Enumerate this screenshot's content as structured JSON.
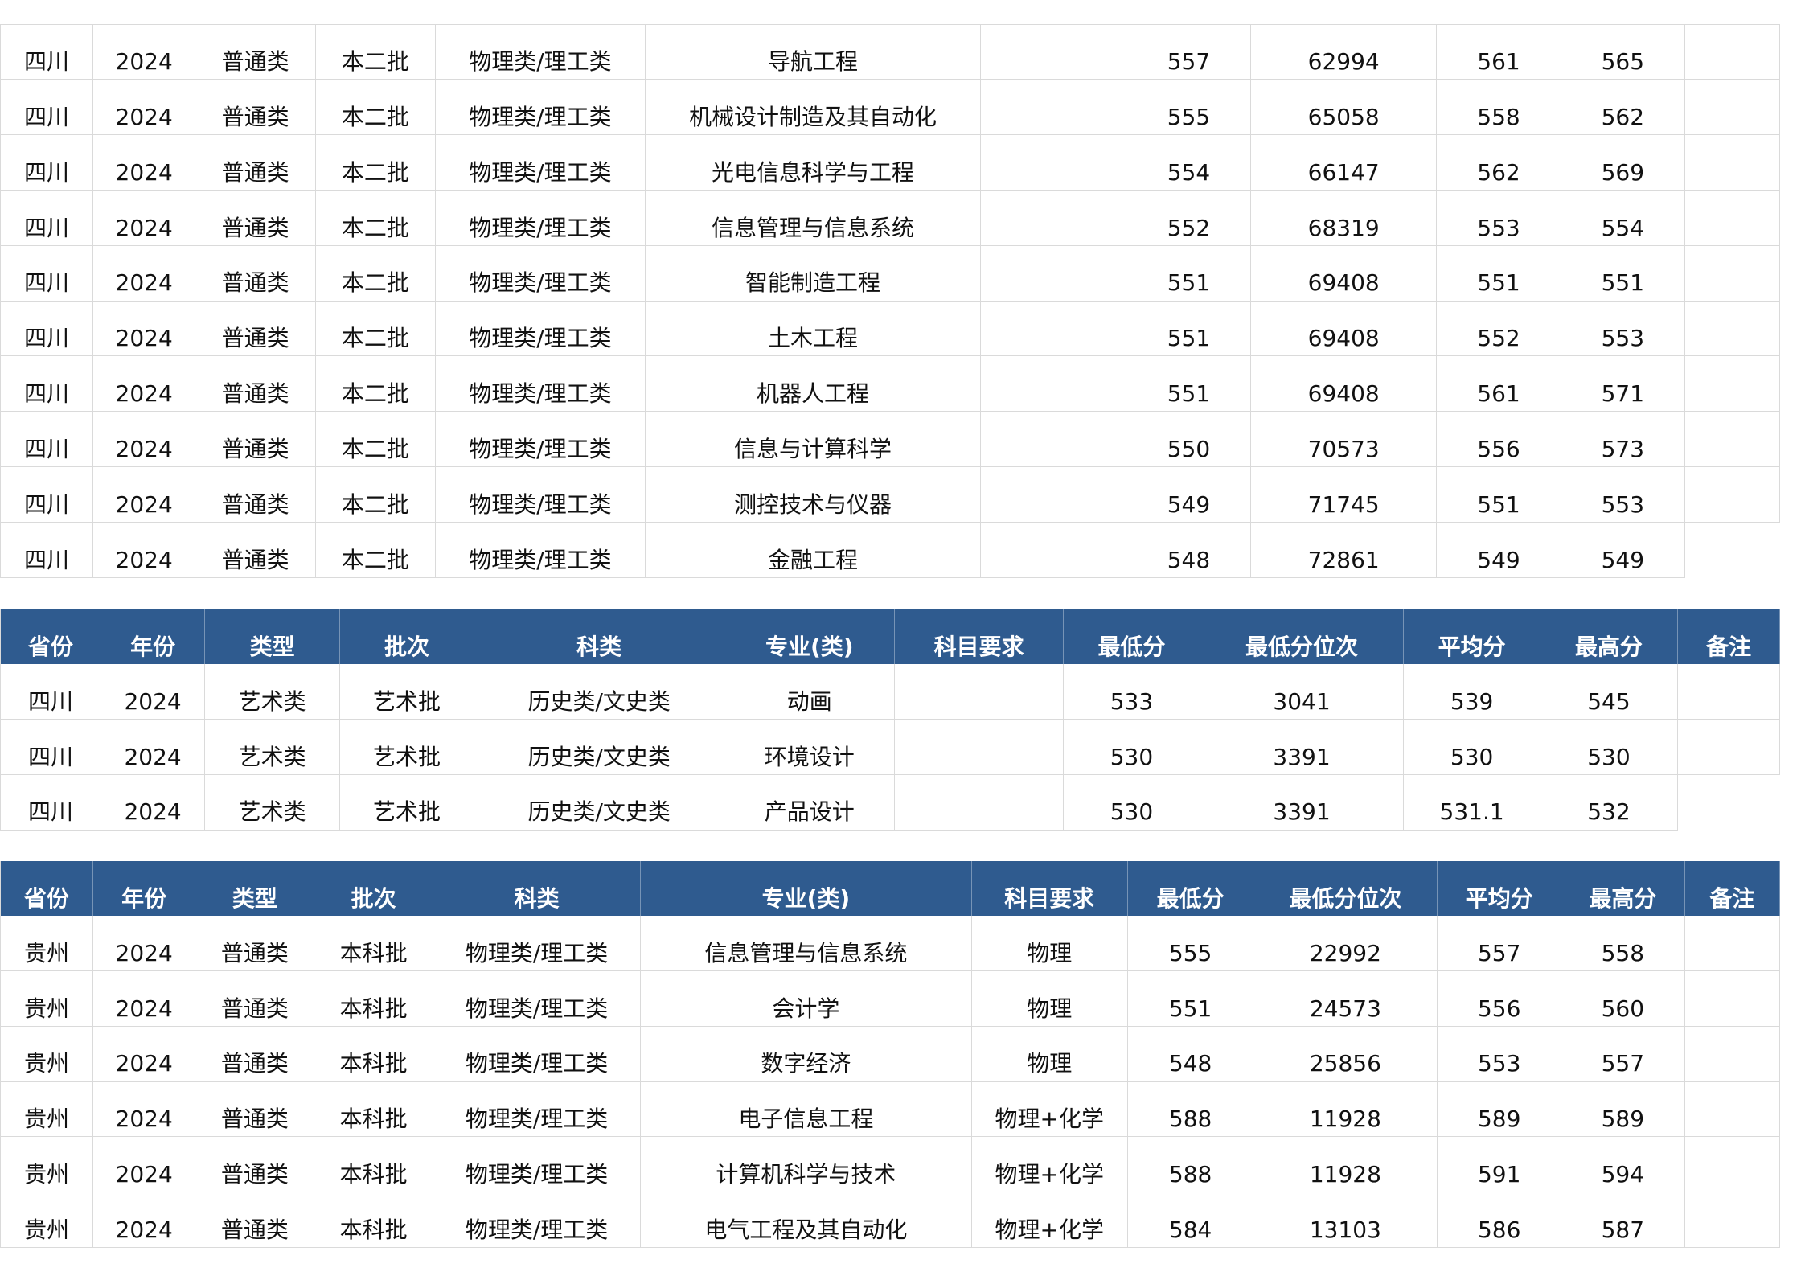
{
  "colors": {
    "header_bg": "#2f5b8f",
    "header_text": "#ffffff",
    "grid": "#dadada",
    "text": "#111111"
  },
  "tables": [
    {
      "rows": [
        [
          "四川",
          "2024",
          "普通类",
          "本二批",
          "物理类/理工类",
          "导航工程",
          "",
          "557",
          "62994",
          "561",
          "565",
          ""
        ],
        [
          "四川",
          "2024",
          "普通类",
          "本二批",
          "物理类/理工类",
          "机械设计制造及其自动化",
          "",
          "555",
          "65058",
          "558",
          "562",
          ""
        ],
        [
          "四川",
          "2024",
          "普通类",
          "本二批",
          "物理类/理工类",
          "光电信息科学与工程",
          "",
          "554",
          "66147",
          "562",
          "569",
          ""
        ],
        [
          "四川",
          "2024",
          "普通类",
          "本二批",
          "物理类/理工类",
          "信息管理与信息系统",
          "",
          "552",
          "68319",
          "553",
          "554",
          ""
        ],
        [
          "四川",
          "2024",
          "普通类",
          "本二批",
          "物理类/理工类",
          "智能制造工程",
          "",
          "551",
          "69408",
          "551",
          "551",
          ""
        ],
        [
          "四川",
          "2024",
          "普通类",
          "本二批",
          "物理类/理工类",
          "土木工程",
          "",
          "551",
          "69408",
          "552",
          "553",
          ""
        ],
        [
          "四川",
          "2024",
          "普通类",
          "本二批",
          "物理类/理工类",
          "机器人工程",
          "",
          "551",
          "69408",
          "561",
          "571",
          ""
        ],
        [
          "四川",
          "2024",
          "普通类",
          "本二批",
          "物理类/理工类",
          "信息与计算科学",
          "",
          "550",
          "70573",
          "556",
          "573",
          ""
        ],
        [
          "四川",
          "2024",
          "普通类",
          "本二批",
          "物理类/理工类",
          "测控技术与仪器",
          "",
          "549",
          "71745",
          "551",
          "553",
          ""
        ],
        [
          "四川",
          "2024",
          "普通类",
          "本二批",
          "物理类/理工类",
          "金融工程",
          "",
          "548",
          "72861",
          "549",
          "549",
          ""
        ]
      ]
    },
    {
      "headers": [
        "省份",
        "年份",
        "类型",
        "批次",
        "科类",
        "专业(类)",
        "科目要求",
        "最低分",
        "最低分位次",
        "平均分",
        "最高分",
        "备注"
      ],
      "rows": [
        [
          "四川",
          "2024",
          "艺术类",
          "艺术批",
          "历史类/文史类",
          "动画",
          "",
          "533",
          "3041",
          "539",
          "545",
          ""
        ],
        [
          "四川",
          "2024",
          "艺术类",
          "艺术批",
          "历史类/文史类",
          "环境设计",
          "",
          "530",
          "3391",
          "530",
          "530",
          ""
        ],
        [
          "四川",
          "2024",
          "艺术类",
          "艺术批",
          "历史类/文史类",
          "产品设计",
          "",
          "530",
          "3391",
          "531.1",
          "532",
          ""
        ]
      ]
    },
    {
      "headers": [
        "省份",
        "年份",
        "类型",
        "批次",
        "科类",
        "专业(类)",
        "科目要求",
        "最低分",
        "最低分位次",
        "平均分",
        "最高分",
        "备注"
      ],
      "rows": [
        [
          "贵州",
          "2024",
          "普通类",
          "本科批",
          "物理类/理工类",
          "信息管理与信息系统",
          "物理",
          "555",
          "22992",
          "557",
          "558",
          ""
        ],
        [
          "贵州",
          "2024",
          "普通类",
          "本科批",
          "物理类/理工类",
          "会计学",
          "物理",
          "551",
          "24573",
          "556",
          "560",
          ""
        ],
        [
          "贵州",
          "2024",
          "普通类",
          "本科批",
          "物理类/理工类",
          "数字经济",
          "物理",
          "548",
          "25856",
          "553",
          "557",
          ""
        ],
        [
          "贵州",
          "2024",
          "普通类",
          "本科批",
          "物理类/理工类",
          "电子信息工程",
          "物理+化学",
          "588",
          "11928",
          "589",
          "589",
          ""
        ],
        [
          "贵州",
          "2024",
          "普通类",
          "本科批",
          "物理类/理工类",
          "计算机科学与技术",
          "物理+化学",
          "588",
          "11928",
          "591",
          "594",
          ""
        ],
        [
          "贵州",
          "2024",
          "普通类",
          "本科批",
          "物理类/理工类",
          "电气工程及其自动化",
          "物理+化学",
          "584",
          "13103",
          "586",
          "587",
          ""
        ]
      ]
    }
  ]
}
